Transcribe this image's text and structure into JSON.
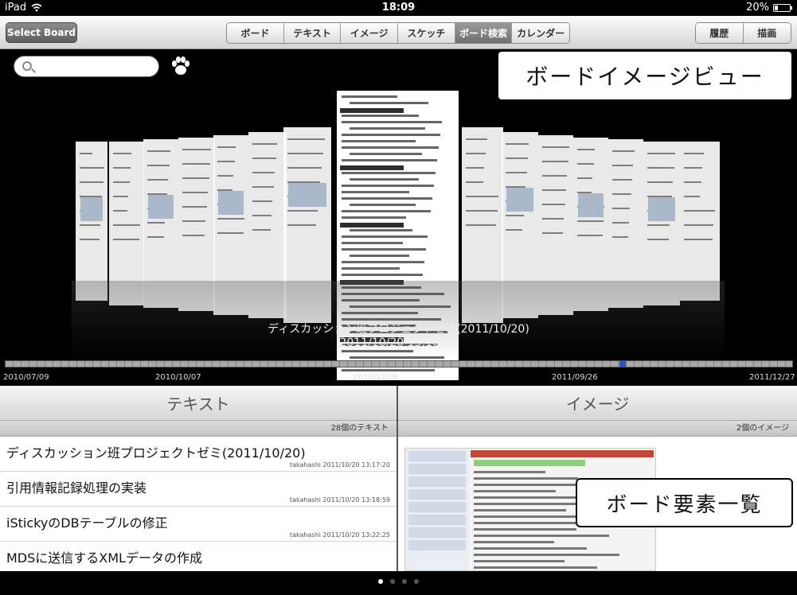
{
  "status_bar": {
    "device": "iPad",
    "time": "18:09",
    "battery": "20%",
    "battery_level": 0.2
  },
  "toolbar": {
    "select_board": "Select Board",
    "tabs": [
      {
        "label": "ボード",
        "active": false
      },
      {
        "label": "テキスト",
        "active": false
      },
      {
        "label": "イメージ",
        "active": false
      },
      {
        "label": "スケッチ",
        "active": false
      },
      {
        "label": "ボード検索",
        "active": true
      },
      {
        "label": "カレンダー",
        "active": false
      }
    ],
    "history": "履歴",
    "draw": "描画"
  },
  "image_view": {
    "callout": "ボードイメージビュー",
    "selected_title": "ディスカッション班プロジェクトゼミ(2011/10/20)",
    "selected_date": "2011/10/20 13:16:25",
    "timeline": {
      "labels": [
        "2010/07/09",
        "2010/10/07",
        "2010/12/06",
        "2011/09/26",
        "2011/12/27"
      ],
      "marker_fraction": 0.78
    }
  },
  "text_pane": {
    "header": "テキスト",
    "count": "28個のテキスト",
    "items": [
      {
        "title": "ディスカッション班プロジェクトゼミ(2011/10/20)",
        "meta": "takahashi 2011/10/20 13:17:20"
      },
      {
        "title": "引用情報記録処理の実装",
        "meta": "takahashi 2011/10/20 13:18:59"
      },
      {
        "title": "iStickyのDBテーブルの修正",
        "meta": "takahashi 2011/10/20 13:22:25"
      },
      {
        "title": "MDSに送信するXMLデータの作成",
        "meta": ""
      }
    ]
  },
  "image_pane": {
    "header": "イメージ",
    "count": "2個のイメージ",
    "callout": "ボード要素一覧"
  },
  "page_dots": {
    "count": 4,
    "current": 1
  }
}
